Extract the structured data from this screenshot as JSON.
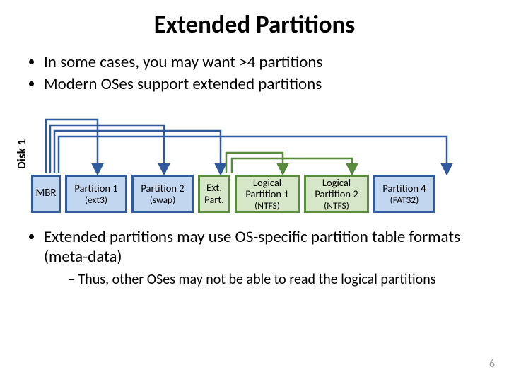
{
  "title": "Extended Partitions",
  "disk_label": "Disk 1",
  "bullets_top": [
    "In some cases, you may want >4 partitions",
    "Modern OSes support extended partitions"
  ],
  "boxes": {
    "mbr": {
      "label": "MBR"
    },
    "p1": {
      "label": "Partition 1",
      "sub": "(ext3)"
    },
    "p2": {
      "label": "Partition 2",
      "sub": "(swap)"
    },
    "ext": {
      "label1": "Ext.",
      "label2": "Part."
    },
    "lp1": {
      "label": "Logical",
      "label2": "Partition 1",
      "sub": "(NTFS)"
    },
    "lp2": {
      "label": "Logical",
      "label2": "Partition 2",
      "sub": "(NTFS)"
    },
    "p4": {
      "label": "Partition 4",
      "sub": "(FAT32)"
    }
  },
  "bullets_bottom": [
    "Extended partitions may use OS-specific partition table formats (meta-data)"
  ],
  "sub_bullets": [
    "Thus, other OSes may not be able to read the logical partitions"
  ],
  "page_number": "6",
  "colors": {
    "blue_arrow": "#2f5a9c",
    "green_arrow": "#5a8a3c"
  }
}
